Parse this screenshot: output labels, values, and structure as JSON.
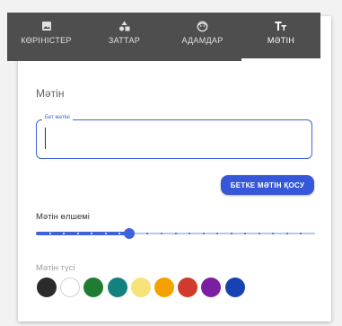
{
  "tabs": [
    {
      "label": "КӨРІНІСТЕР",
      "icon": "image-icon",
      "active": false
    },
    {
      "label": "ЗАТТАР",
      "icon": "shapes-icon",
      "active": false
    },
    {
      "label": "АДАМДАР",
      "icon": "face-icon",
      "active": false
    },
    {
      "label": "МӘТІН",
      "icon": "text-icon",
      "active": true
    }
  ],
  "section_title": "Мәтін",
  "text_field": {
    "label": "Бет мәтіні",
    "value": ""
  },
  "add_button_label": "БЕТКЕ МӘТІН ҚОСУ",
  "size": {
    "label": "Мәтін өлшемі",
    "value": 0.33,
    "steps": 20
  },
  "color": {
    "label": "Мәтін түсі",
    "swatches": [
      "#2b2b2b",
      "#ffffff",
      "#1e7d32",
      "#12817f",
      "#f7e27a",
      "#f5a200",
      "#d13b2e",
      "#7a1fa2",
      "#1642b3"
    ]
  },
  "colors": {
    "accent": "#3f62d8",
    "tabbar": "#4e4e4e"
  }
}
